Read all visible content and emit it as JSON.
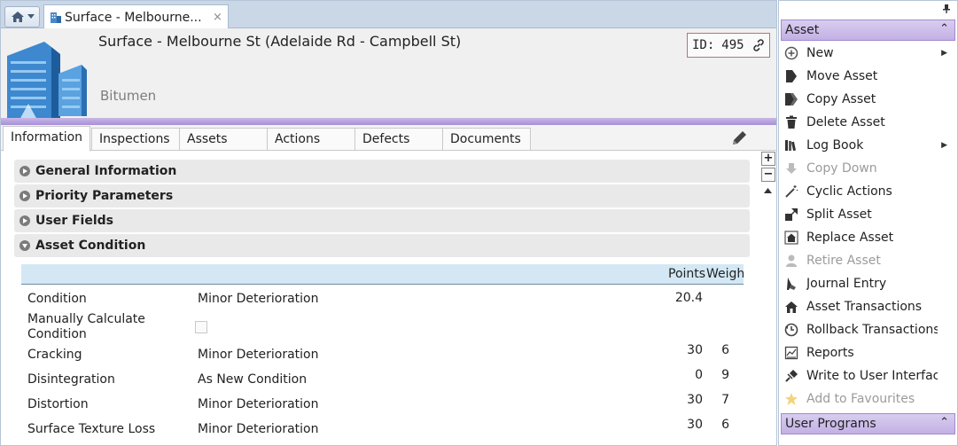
{
  "doc_tab": {
    "label": "Surface - Melbourne...",
    "close": "×"
  },
  "header": {
    "title": "Surface - Melbourne St (Adelaide Rd - Campbell St)",
    "subtitle": "Bitumen",
    "id_label": "ID:",
    "id_value": "495"
  },
  "tabs": [
    "Information",
    "Inspections",
    "Assets",
    "Actions",
    "Defects",
    "Documents"
  ],
  "sections": [
    {
      "label": "General Information",
      "expanded": false
    },
    {
      "label": "Priority Parameters",
      "expanded": false
    },
    {
      "label": "User Fields",
      "expanded": false
    },
    {
      "label": "Asset Condition",
      "expanded": true
    }
  ],
  "condition_table": {
    "headers": {
      "points": "Points",
      "weight": "Weight"
    },
    "rows": [
      {
        "label": "Condition",
        "value": "Minor Deterioration",
        "points": "20.4",
        "weight": ""
      },
      {
        "label": "Manually Calculate Condition",
        "value": "",
        "points": "",
        "weight": ""
      },
      {
        "label": "Cracking",
        "value": "Minor Deterioration",
        "points": "30",
        "weight": "6"
      },
      {
        "label": "Disintegration",
        "value": "As New Condition",
        "points": "0",
        "weight": "9"
      },
      {
        "label": "Distortion",
        "value": "Minor Deterioration",
        "points": "30",
        "weight": "7"
      },
      {
        "label": "Surface Texture Loss",
        "value": "Minor Deterioration",
        "points": "30",
        "weight": "6"
      }
    ]
  },
  "side_menu": {
    "header": "Asset",
    "footer_header": "User Programs",
    "items": [
      {
        "label": "New",
        "icon": "plus-circle-icon",
        "disabled": false,
        "submenu": true
      },
      {
        "label": "Move Asset",
        "icon": "move-icon",
        "disabled": false,
        "submenu": false
      },
      {
        "label": "Copy Asset",
        "icon": "copy-icon",
        "disabled": false,
        "submenu": false
      },
      {
        "label": "Delete Asset",
        "icon": "trash-icon",
        "disabled": false,
        "submenu": false
      },
      {
        "label": "Log Book",
        "icon": "books-icon",
        "disabled": false,
        "submenu": true
      },
      {
        "label": "Copy Down",
        "icon": "copy-down-icon",
        "disabled": true,
        "submenu": false
      },
      {
        "label": "Cyclic Actions",
        "icon": "wand-icon",
        "disabled": false,
        "submenu": false
      },
      {
        "label": "Split Asset",
        "icon": "split-icon",
        "disabled": false,
        "submenu": false
      },
      {
        "label": "Replace Asset",
        "icon": "house-replace-icon",
        "disabled": false,
        "submenu": false
      },
      {
        "label": "Retire Asset",
        "icon": "person-icon",
        "disabled": true,
        "submenu": false
      },
      {
        "label": "Journal Entry",
        "icon": "journal-icon",
        "disabled": false,
        "submenu": false
      },
      {
        "label": "Asset Transactions",
        "icon": "house-icon",
        "disabled": false,
        "submenu": false
      },
      {
        "label": "Rollback Transactions",
        "icon": "rollback-icon",
        "disabled": false,
        "submenu": false
      },
      {
        "label": "Reports",
        "icon": "report-icon",
        "disabled": false,
        "submenu": false
      },
      {
        "label": "Write to User Interface",
        "icon": "plug-icon",
        "disabled": false,
        "submenu": false
      },
      {
        "label": "Add to Favourites",
        "icon": "star-icon",
        "disabled": true,
        "submenu": false
      }
    ]
  }
}
